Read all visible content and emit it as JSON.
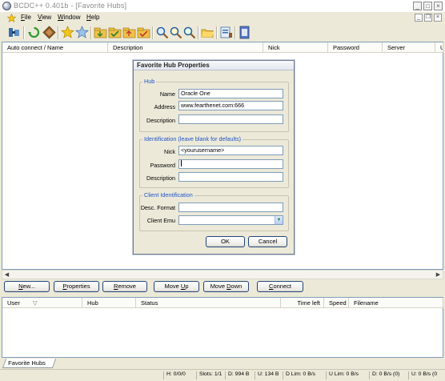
{
  "window": {
    "title": "BCDC++ 0.401b - [Favorite Hubs]",
    "controls": {
      "minimize": "_",
      "maximize": "□",
      "close": "×"
    }
  },
  "menu": {
    "items": [
      {
        "label": "File",
        "key": "F",
        "rest": "ile"
      },
      {
        "label": "View",
        "key": "V",
        "rest": "iew"
      },
      {
        "label": "Window",
        "key": "W",
        "rest": "indow"
      },
      {
        "label": "Help",
        "key": "H",
        "rest": "elp"
      }
    ],
    "mdi_controls": {
      "minimize": "_",
      "restore": "❐",
      "close": "×"
    }
  },
  "toolbar": {
    "icons": [
      "connect-icon",
      "refresh-icon",
      "reconnect-icon",
      "favorite-hubs-icon",
      "favorite-users-icon",
      "queue-icon",
      "finished-icon",
      "upload-queue-icon",
      "finished-uploads-icon",
      "search-icon",
      "adl-search-icon",
      "search-spy-icon",
      "open-file-list-icon",
      "settings-icon",
      "notepad-icon"
    ]
  },
  "hub_list": {
    "columns": [
      "Auto connect / Name",
      "Description",
      "Nick",
      "Password",
      "Server",
      "U"
    ]
  },
  "buttons": {
    "new": {
      "label": "New...",
      "key": "N",
      "rest": "ew..."
    },
    "properties": {
      "label": "Properties",
      "key": "P",
      "rest": "roperties"
    },
    "remove": {
      "label": "Remove",
      "key": "R",
      "rest": "emove"
    },
    "move_up": {
      "label": "Move Up",
      "pre": "Move ",
      "key": "U",
      "rest": "p"
    },
    "move_down": {
      "label": "Move Down",
      "pre": "Move ",
      "key": "D",
      "rest": "own"
    },
    "connect": {
      "label": "Connect",
      "key": "C",
      "rest": "onnect"
    }
  },
  "transfer_list": {
    "columns": [
      "User",
      "Hub",
      "Status",
      "Time left",
      "Speed",
      "Filename"
    ],
    "sort_indicator": "▽"
  },
  "tabs": [
    {
      "label": "Favorite Hubs"
    }
  ],
  "status_bar": {
    "hubs": "H: 0/0/0",
    "slots": "Slots: 1/1",
    "downloaded": "D: 994 B",
    "uploaded": "U: 134 B",
    "d_lim": "D Lim: 0 B/s",
    "u_lim": "U Lim: 0 B/s",
    "d_rate": "D: 0 B/s (0)",
    "u_rate": "U: 0 B/s (0"
  },
  "dialog": {
    "title": "Favorite Hub Properties",
    "hub_group": {
      "caption": "Hub",
      "name_label": "Name",
      "name_value": "Oracle One",
      "address_label": "Address",
      "address_value": "www.fearthenet.com:666",
      "description_label": "Description",
      "description_value": ""
    },
    "ident_group": {
      "caption": "Identification (leave blank for defaults)",
      "nick_label": "Nick",
      "nick_value": "<yourusername>",
      "password_label": "Password",
      "password_value": "",
      "description_label": "Description",
      "description_value": ""
    },
    "client_group": {
      "caption": "Client Identification",
      "desc_format_label": "Desc. Format",
      "desc_format_value": "",
      "client_emu_label": "Client Emu",
      "client_emu_value": ""
    },
    "ok_label": "OK",
    "cancel_label": "Cancel"
  }
}
